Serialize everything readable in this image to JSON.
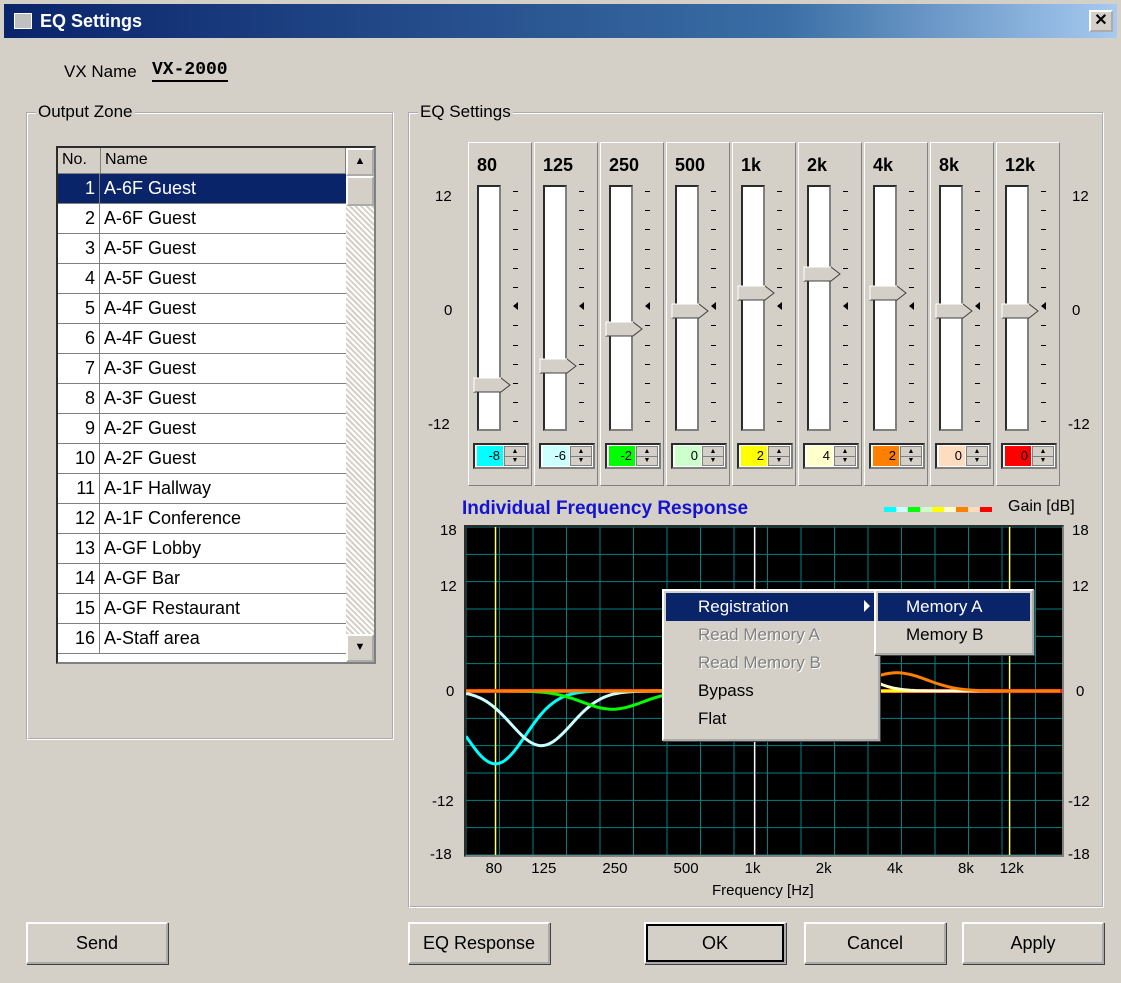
{
  "window": {
    "title": "EQ Settings",
    "close_icon": "close-icon"
  },
  "vx": {
    "label": "VX Name",
    "value": "VX-2000"
  },
  "output_zone": {
    "title": "Output Zone",
    "headers": {
      "no": "No.",
      "name": "Name"
    },
    "rows": [
      {
        "no": "1",
        "name": "A-6F Guest"
      },
      {
        "no": "2",
        "name": "A-6F Guest"
      },
      {
        "no": "3",
        "name": "A-5F Guest"
      },
      {
        "no": "4",
        "name": "A-5F Guest"
      },
      {
        "no": "5",
        "name": "A-4F Guest"
      },
      {
        "no": "6",
        "name": "A-4F Guest"
      },
      {
        "no": "7",
        "name": "A-3F Guest"
      },
      {
        "no": "8",
        "name": "A-3F Guest"
      },
      {
        "no": "9",
        "name": "A-2F Guest"
      },
      {
        "no": "10",
        "name": "A-2F Guest"
      },
      {
        "no": "11",
        "name": "A-1F Hallway"
      },
      {
        "no": "12",
        "name": "A-1F Conference"
      },
      {
        "no": "13",
        "name": "A-GF Lobby"
      },
      {
        "no": "14",
        "name": "A-GF Bar"
      },
      {
        "no": "15",
        "name": "A-GF Restaurant"
      },
      {
        "no": "16",
        "name": "A-Staff area"
      }
    ],
    "selected_index": 0
  },
  "eq": {
    "title": "EQ Settings",
    "scale": {
      "top": "12",
      "mid": "0",
      "bottom": "-12"
    },
    "bands": [
      {
        "label": "80",
        "value": "-8",
        "color": "#00ffff"
      },
      {
        "label": "125",
        "value": "-6",
        "color": "#ccffff"
      },
      {
        "label": "250",
        "value": "-2",
        "color": "#00ff00"
      },
      {
        "label": "500",
        "value": "0",
        "color": "#ccffcc"
      },
      {
        "label": "1k",
        "value": "2",
        "color": "#ffff00"
      },
      {
        "label": "2k",
        "value": "4",
        "color": "#ffffcc"
      },
      {
        "label": "4k",
        "value": "2",
        "color": "#ff8000"
      },
      {
        "label": "8k",
        "value": "0",
        "color": "#ffdcc0"
      },
      {
        "label": "12k",
        "value": "0",
        "color": "#ff0000"
      }
    ]
  },
  "graph": {
    "title": "Individual Frequency Response",
    "gain_label": "Gain [dB]",
    "xlabel": "Frequency [Hz]",
    "yticks": [
      "18",
      "12",
      "0",
      "-12",
      "-18"
    ],
    "xticks": [
      "80",
      "125",
      "250",
      "500",
      "1k",
      "2k",
      "4k",
      "8k",
      "12k"
    ]
  },
  "context_menu": {
    "items": [
      {
        "label": "Registration",
        "enabled": true,
        "highlighted": true,
        "submenu": true
      },
      {
        "label": "Read Memory A",
        "enabled": false
      },
      {
        "label": "Read Memory B",
        "enabled": false
      },
      {
        "label": "Bypass",
        "enabled": true
      },
      {
        "label": "Flat",
        "enabled": true
      }
    ],
    "submenu": [
      {
        "label": "Memory A",
        "highlighted": true
      },
      {
        "label": "Memory B"
      }
    ]
  },
  "buttons": {
    "send": "Send",
    "eq_response": "EQ Response",
    "ok": "OK",
    "cancel": "Cancel",
    "apply": "Apply"
  }
}
